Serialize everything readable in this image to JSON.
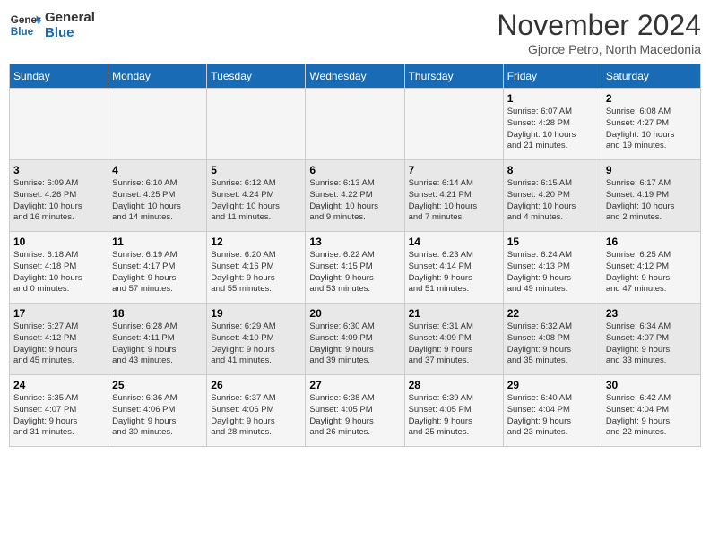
{
  "logo": {
    "general": "General",
    "blue": "Blue"
  },
  "header": {
    "month": "November 2024",
    "location": "Gjorce Petro, North Macedonia"
  },
  "days_of_week": [
    "Sunday",
    "Monday",
    "Tuesday",
    "Wednesday",
    "Thursday",
    "Friday",
    "Saturday"
  ],
  "weeks": [
    [
      {
        "day": "",
        "info": ""
      },
      {
        "day": "",
        "info": ""
      },
      {
        "day": "",
        "info": ""
      },
      {
        "day": "",
        "info": ""
      },
      {
        "day": "",
        "info": ""
      },
      {
        "day": "1",
        "info": "Sunrise: 6:07 AM\nSunset: 4:28 PM\nDaylight: 10 hours\nand 21 minutes."
      },
      {
        "day": "2",
        "info": "Sunrise: 6:08 AM\nSunset: 4:27 PM\nDaylight: 10 hours\nand 19 minutes."
      }
    ],
    [
      {
        "day": "3",
        "info": "Sunrise: 6:09 AM\nSunset: 4:26 PM\nDaylight: 10 hours\nand 16 minutes."
      },
      {
        "day": "4",
        "info": "Sunrise: 6:10 AM\nSunset: 4:25 PM\nDaylight: 10 hours\nand 14 minutes."
      },
      {
        "day": "5",
        "info": "Sunrise: 6:12 AM\nSunset: 4:24 PM\nDaylight: 10 hours\nand 11 minutes."
      },
      {
        "day": "6",
        "info": "Sunrise: 6:13 AM\nSunset: 4:22 PM\nDaylight: 10 hours\nand 9 minutes."
      },
      {
        "day": "7",
        "info": "Sunrise: 6:14 AM\nSunset: 4:21 PM\nDaylight: 10 hours\nand 7 minutes."
      },
      {
        "day": "8",
        "info": "Sunrise: 6:15 AM\nSunset: 4:20 PM\nDaylight: 10 hours\nand 4 minutes."
      },
      {
        "day": "9",
        "info": "Sunrise: 6:17 AM\nSunset: 4:19 PM\nDaylight: 10 hours\nand 2 minutes."
      }
    ],
    [
      {
        "day": "10",
        "info": "Sunrise: 6:18 AM\nSunset: 4:18 PM\nDaylight: 10 hours\nand 0 minutes."
      },
      {
        "day": "11",
        "info": "Sunrise: 6:19 AM\nSunset: 4:17 PM\nDaylight: 9 hours\nand 57 minutes."
      },
      {
        "day": "12",
        "info": "Sunrise: 6:20 AM\nSunset: 4:16 PM\nDaylight: 9 hours\nand 55 minutes."
      },
      {
        "day": "13",
        "info": "Sunrise: 6:22 AM\nSunset: 4:15 PM\nDaylight: 9 hours\nand 53 minutes."
      },
      {
        "day": "14",
        "info": "Sunrise: 6:23 AM\nSunset: 4:14 PM\nDaylight: 9 hours\nand 51 minutes."
      },
      {
        "day": "15",
        "info": "Sunrise: 6:24 AM\nSunset: 4:13 PM\nDaylight: 9 hours\nand 49 minutes."
      },
      {
        "day": "16",
        "info": "Sunrise: 6:25 AM\nSunset: 4:12 PM\nDaylight: 9 hours\nand 47 minutes."
      }
    ],
    [
      {
        "day": "17",
        "info": "Sunrise: 6:27 AM\nSunset: 4:12 PM\nDaylight: 9 hours\nand 45 minutes."
      },
      {
        "day": "18",
        "info": "Sunrise: 6:28 AM\nSunset: 4:11 PM\nDaylight: 9 hours\nand 43 minutes."
      },
      {
        "day": "19",
        "info": "Sunrise: 6:29 AM\nSunset: 4:10 PM\nDaylight: 9 hours\nand 41 minutes."
      },
      {
        "day": "20",
        "info": "Sunrise: 6:30 AM\nSunset: 4:09 PM\nDaylight: 9 hours\nand 39 minutes."
      },
      {
        "day": "21",
        "info": "Sunrise: 6:31 AM\nSunset: 4:09 PM\nDaylight: 9 hours\nand 37 minutes."
      },
      {
        "day": "22",
        "info": "Sunrise: 6:32 AM\nSunset: 4:08 PM\nDaylight: 9 hours\nand 35 minutes."
      },
      {
        "day": "23",
        "info": "Sunrise: 6:34 AM\nSunset: 4:07 PM\nDaylight: 9 hours\nand 33 minutes."
      }
    ],
    [
      {
        "day": "24",
        "info": "Sunrise: 6:35 AM\nSunset: 4:07 PM\nDaylight: 9 hours\nand 31 minutes."
      },
      {
        "day": "25",
        "info": "Sunrise: 6:36 AM\nSunset: 4:06 PM\nDaylight: 9 hours\nand 30 minutes."
      },
      {
        "day": "26",
        "info": "Sunrise: 6:37 AM\nSunset: 4:06 PM\nDaylight: 9 hours\nand 28 minutes."
      },
      {
        "day": "27",
        "info": "Sunrise: 6:38 AM\nSunset: 4:05 PM\nDaylight: 9 hours\nand 26 minutes."
      },
      {
        "day": "28",
        "info": "Sunrise: 6:39 AM\nSunset: 4:05 PM\nDaylight: 9 hours\nand 25 minutes."
      },
      {
        "day": "29",
        "info": "Sunrise: 6:40 AM\nSunset: 4:04 PM\nDaylight: 9 hours\nand 23 minutes."
      },
      {
        "day": "30",
        "info": "Sunrise: 6:42 AM\nSunset: 4:04 PM\nDaylight: 9 hours\nand 22 minutes."
      }
    ]
  ]
}
